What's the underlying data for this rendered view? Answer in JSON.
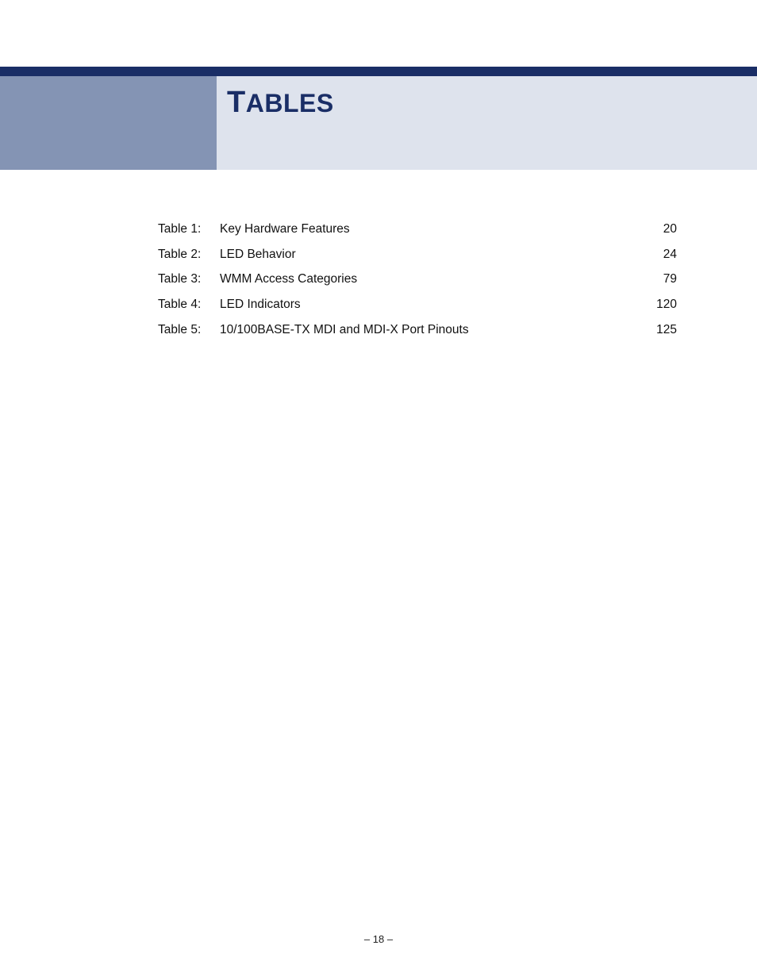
{
  "header": {
    "title_cap": "T",
    "title_rest": "ABLES"
  },
  "toc": {
    "rows": [
      {
        "num": "Table 1:",
        "title": "Key Hardware Features",
        "page": "20"
      },
      {
        "num": "Table 2:",
        "title": "LED Behavior",
        "page": "24"
      },
      {
        "num": "Table 3:",
        "title": "WMM Access Categories",
        "page": "79"
      },
      {
        "num": "Table 4:",
        "title": "LED Indicators",
        "page": "120"
      },
      {
        "num": "Table 5:",
        "title": "10/100BASE-TX MDI and MDI-X Port Pinouts",
        "page": "125"
      }
    ]
  },
  "footer": {
    "text": "–  18  –"
  }
}
